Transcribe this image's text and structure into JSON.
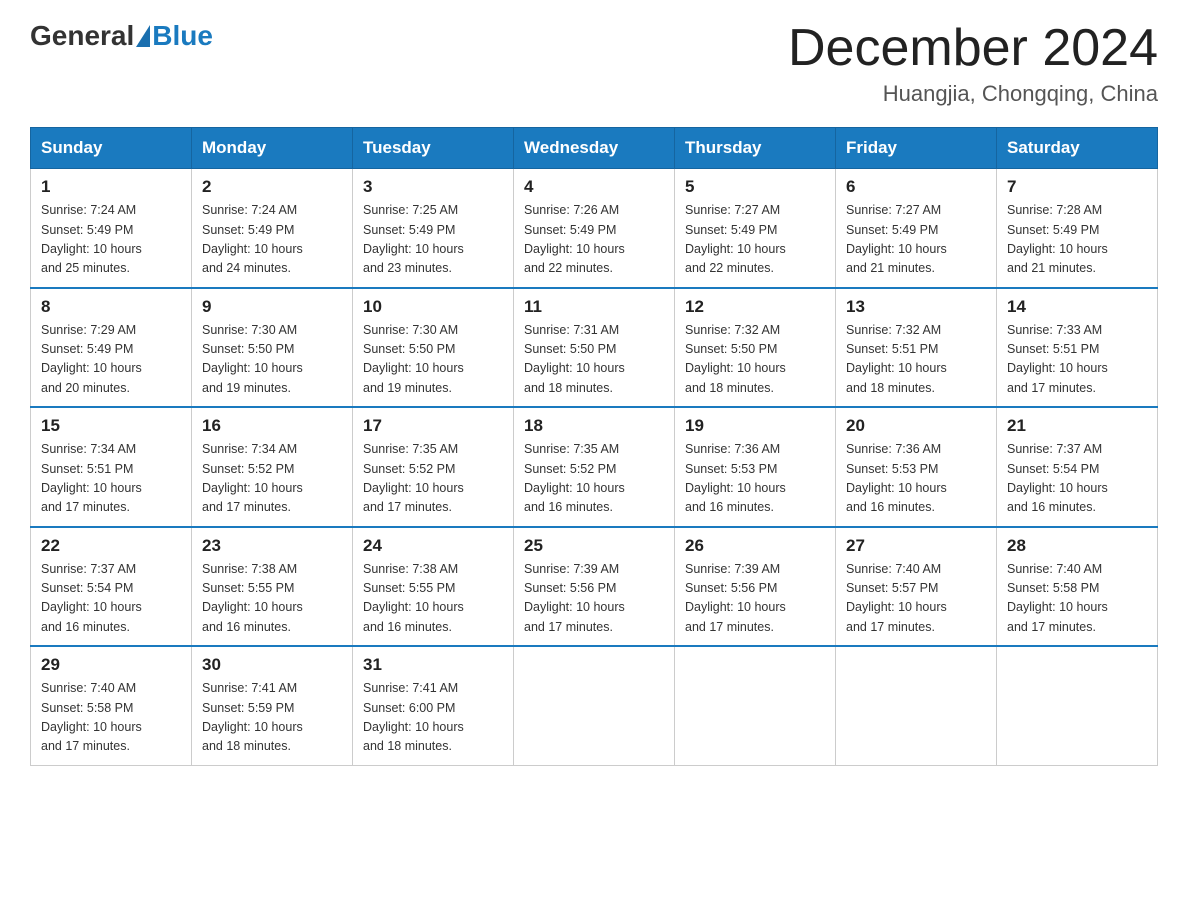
{
  "header": {
    "logo_general": "General",
    "logo_blue": "Blue",
    "month_title": "December 2024",
    "location": "Huangjia, Chongqing, China"
  },
  "days_of_week": [
    "Sunday",
    "Monday",
    "Tuesday",
    "Wednesday",
    "Thursday",
    "Friday",
    "Saturday"
  ],
  "weeks": [
    [
      {
        "day": "1",
        "sunrise": "7:24 AM",
        "sunset": "5:49 PM",
        "daylight_h": "10",
        "daylight_m": "25"
      },
      {
        "day": "2",
        "sunrise": "7:24 AM",
        "sunset": "5:49 PM",
        "daylight_h": "10",
        "daylight_m": "24"
      },
      {
        "day": "3",
        "sunrise": "7:25 AM",
        "sunset": "5:49 PM",
        "daylight_h": "10",
        "daylight_m": "23"
      },
      {
        "day": "4",
        "sunrise": "7:26 AM",
        "sunset": "5:49 PM",
        "daylight_h": "10",
        "daylight_m": "22"
      },
      {
        "day": "5",
        "sunrise": "7:27 AM",
        "sunset": "5:49 PM",
        "daylight_h": "10",
        "daylight_m": "22"
      },
      {
        "day": "6",
        "sunrise": "7:27 AM",
        "sunset": "5:49 PM",
        "daylight_h": "10",
        "daylight_m": "21"
      },
      {
        "day": "7",
        "sunrise": "7:28 AM",
        "sunset": "5:49 PM",
        "daylight_h": "10",
        "daylight_m": "21"
      }
    ],
    [
      {
        "day": "8",
        "sunrise": "7:29 AM",
        "sunset": "5:49 PM",
        "daylight_h": "10",
        "daylight_m": "20"
      },
      {
        "day": "9",
        "sunrise": "7:30 AM",
        "sunset": "5:50 PM",
        "daylight_h": "10",
        "daylight_m": "19"
      },
      {
        "day": "10",
        "sunrise": "7:30 AM",
        "sunset": "5:50 PM",
        "daylight_h": "10",
        "daylight_m": "19"
      },
      {
        "day": "11",
        "sunrise": "7:31 AM",
        "sunset": "5:50 PM",
        "daylight_h": "10",
        "daylight_m": "18"
      },
      {
        "day": "12",
        "sunrise": "7:32 AM",
        "sunset": "5:50 PM",
        "daylight_h": "10",
        "daylight_m": "18"
      },
      {
        "day": "13",
        "sunrise": "7:32 AM",
        "sunset": "5:51 PM",
        "daylight_h": "10",
        "daylight_m": "18"
      },
      {
        "day": "14",
        "sunrise": "7:33 AM",
        "sunset": "5:51 PM",
        "daylight_h": "10",
        "daylight_m": "17"
      }
    ],
    [
      {
        "day": "15",
        "sunrise": "7:34 AM",
        "sunset": "5:51 PM",
        "daylight_h": "10",
        "daylight_m": "17"
      },
      {
        "day": "16",
        "sunrise": "7:34 AM",
        "sunset": "5:52 PM",
        "daylight_h": "10",
        "daylight_m": "17"
      },
      {
        "day": "17",
        "sunrise": "7:35 AM",
        "sunset": "5:52 PM",
        "daylight_h": "10",
        "daylight_m": "17"
      },
      {
        "day": "18",
        "sunrise": "7:35 AM",
        "sunset": "5:52 PM",
        "daylight_h": "10",
        "daylight_m": "16"
      },
      {
        "day": "19",
        "sunrise": "7:36 AM",
        "sunset": "5:53 PM",
        "daylight_h": "10",
        "daylight_m": "16"
      },
      {
        "day": "20",
        "sunrise": "7:36 AM",
        "sunset": "5:53 PM",
        "daylight_h": "10",
        "daylight_m": "16"
      },
      {
        "day": "21",
        "sunrise": "7:37 AM",
        "sunset": "5:54 PM",
        "daylight_h": "10",
        "daylight_m": "16"
      }
    ],
    [
      {
        "day": "22",
        "sunrise": "7:37 AM",
        "sunset": "5:54 PM",
        "daylight_h": "10",
        "daylight_m": "16"
      },
      {
        "day": "23",
        "sunrise": "7:38 AM",
        "sunset": "5:55 PM",
        "daylight_h": "10",
        "daylight_m": "16"
      },
      {
        "day": "24",
        "sunrise": "7:38 AM",
        "sunset": "5:55 PM",
        "daylight_h": "10",
        "daylight_m": "16"
      },
      {
        "day": "25",
        "sunrise": "7:39 AM",
        "sunset": "5:56 PM",
        "daylight_h": "10",
        "daylight_m": "17"
      },
      {
        "day": "26",
        "sunrise": "7:39 AM",
        "sunset": "5:56 PM",
        "daylight_h": "10",
        "daylight_m": "17"
      },
      {
        "day": "27",
        "sunrise": "7:40 AM",
        "sunset": "5:57 PM",
        "daylight_h": "10",
        "daylight_m": "17"
      },
      {
        "day": "28",
        "sunrise": "7:40 AM",
        "sunset": "5:58 PM",
        "daylight_h": "10",
        "daylight_m": "17"
      }
    ],
    [
      {
        "day": "29",
        "sunrise": "7:40 AM",
        "sunset": "5:58 PM",
        "daylight_h": "10",
        "daylight_m": "17"
      },
      {
        "day": "30",
        "sunrise": "7:41 AM",
        "sunset": "5:59 PM",
        "daylight_h": "10",
        "daylight_m": "18"
      },
      {
        "day": "31",
        "sunrise": "7:41 AM",
        "sunset": "6:00 PM",
        "daylight_h": "10",
        "daylight_m": "18"
      },
      null,
      null,
      null,
      null
    ]
  ],
  "labels": {
    "sunrise": "Sunrise:",
    "sunset": "Sunset:",
    "daylight": "Daylight: 10 hours"
  }
}
